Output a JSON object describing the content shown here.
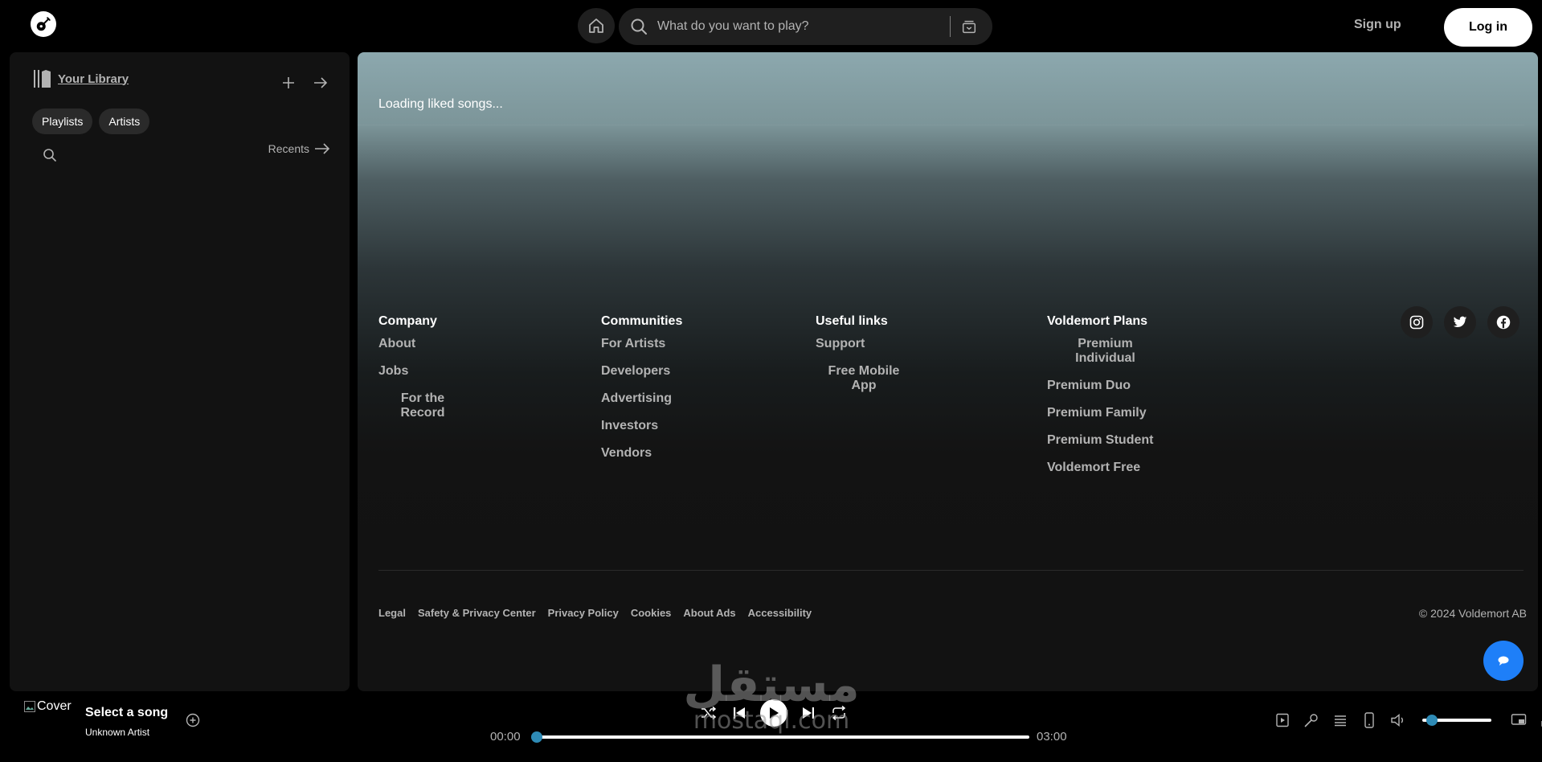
{
  "topbar": {
    "search_placeholder": "What do you want to play?",
    "signup_label": "Sign up",
    "login_label": "Log in"
  },
  "sidebar": {
    "title": "Your Library",
    "chips": [
      "Playlists",
      "Artists"
    ],
    "recents_label": "Recents"
  },
  "main": {
    "loading_text": "Loading liked songs...",
    "footer": {
      "columns": [
        {
          "heading": "Company",
          "links": [
            "About",
            "Jobs",
            "For the Record"
          ]
        },
        {
          "heading": "Communities",
          "links": [
            "For Artists",
            "Developers",
            "Advertising",
            "Investors",
            "Vendors"
          ]
        },
        {
          "heading": "Useful links",
          "links": [
            "Support",
            "Free Mobile App"
          ]
        },
        {
          "heading": "Voldemort Plans",
          "links": [
            "Premium Individual",
            "Premium Duo",
            "Premium Family",
            "Premium Student",
            "Voldemort Free"
          ]
        }
      ],
      "legal_links": [
        "Legal",
        "Safety & Privacy Center",
        "Privacy Policy",
        "Cookies",
        "About Ads",
        "Accessibility"
      ],
      "copyright": "© 2024 Voldemort AB"
    }
  },
  "player": {
    "cover_alt": "Cover",
    "song_title": "Select a song",
    "song_artist": "Unknown Artist",
    "time_current": "00:00",
    "time_total": "03:00",
    "progress_fraction": 0.0,
    "volume_fraction": 0.1
  },
  "watermark": {
    "arabic": "مستقل",
    "latin": "mostaql.com"
  },
  "colors": {
    "accent_knob": "#2e8bb6",
    "chat_button": "#1e7ff8"
  }
}
